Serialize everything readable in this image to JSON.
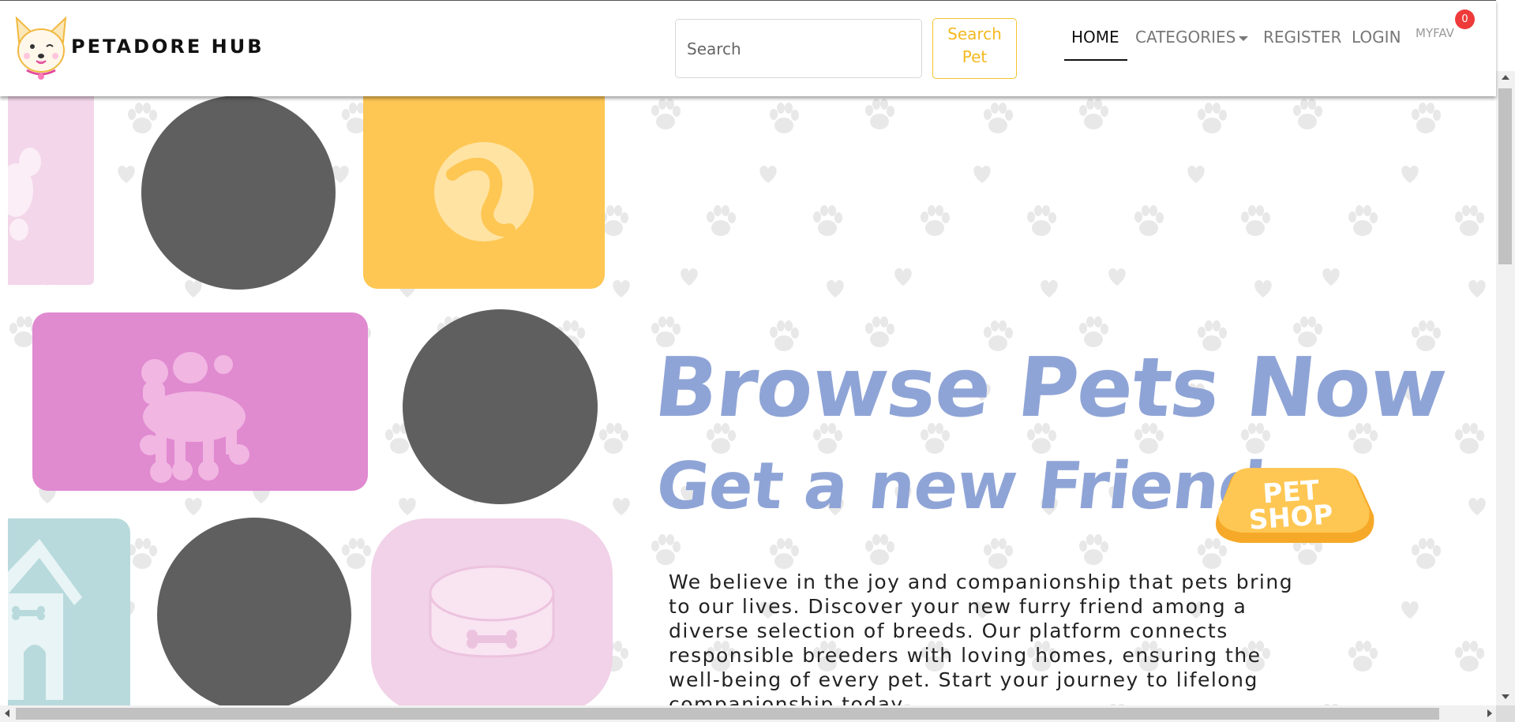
{
  "brand": {
    "name": "PETADORE HUB"
  },
  "search": {
    "placeholder": "Search",
    "button_label": "Search Pet"
  },
  "nav": {
    "links": [
      {
        "label": "HOME",
        "active": true
      },
      {
        "label": "CATEGORIES",
        "dropdown": true
      },
      {
        "label": "REGISTER"
      },
      {
        "label": "LOGIN"
      }
    ],
    "favorites": {
      "label": "MYFAV",
      "count": "0"
    }
  },
  "hero": {
    "headline": "Browse Pets Now",
    "subheadline": "Get a new Friend",
    "badge": "PET SHOP",
    "description": "We believe in the joy and companionship that pets bring to our lives. Discover your new furry friend among a diverse selection of breeds. Our platform connects responsible breeders with loving homes, ensuring the well-being of every pet. Start your journey to lifelong companionship today."
  },
  "tiles": [
    {
      "icon": "paw-icon",
      "color": "#f3d6ea"
    },
    {
      "icon": "tennis-ball-icon",
      "color": "#fec753"
    },
    {
      "icon": "poodle-icon",
      "color": "#e08ad0"
    },
    {
      "icon": "dog-house-icon",
      "color": "#b8dadd"
    },
    {
      "icon": "pet-bowl-icon",
      "color": "#f1d2e8"
    }
  ],
  "colors": {
    "headline": "#8fa4d6",
    "accent_yellow": "#f4c430",
    "badge_red": "#ee3a3a",
    "avatar_placeholder": "#5f5f5f",
    "pattern": "#e8e8e8"
  }
}
